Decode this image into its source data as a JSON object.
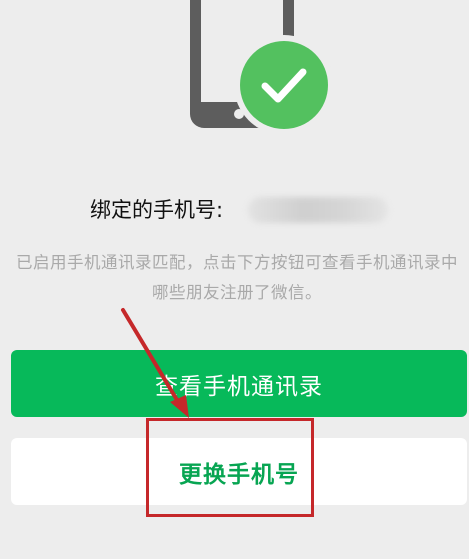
{
  "illustration": {
    "phone_icon": "phone-icon",
    "check_icon": "checkmark-icon",
    "check_color": "#53c15f"
  },
  "binding": {
    "label": "绑定的手机号:",
    "masked_number_icon": "blurred-phone-number"
  },
  "description": "已启用手机通讯录匹配，点击下方按钮可查看手机通讯录中哪些朋友注册了微信。",
  "buttons": {
    "view_contacts": "查看手机通讯录",
    "change_number": "更换手机号"
  },
  "annotation": {
    "arrow_color": "#c5282a",
    "box_color": "#c5282a"
  },
  "colors": {
    "primary_green": "#07b95a",
    "background": "#ededed"
  }
}
